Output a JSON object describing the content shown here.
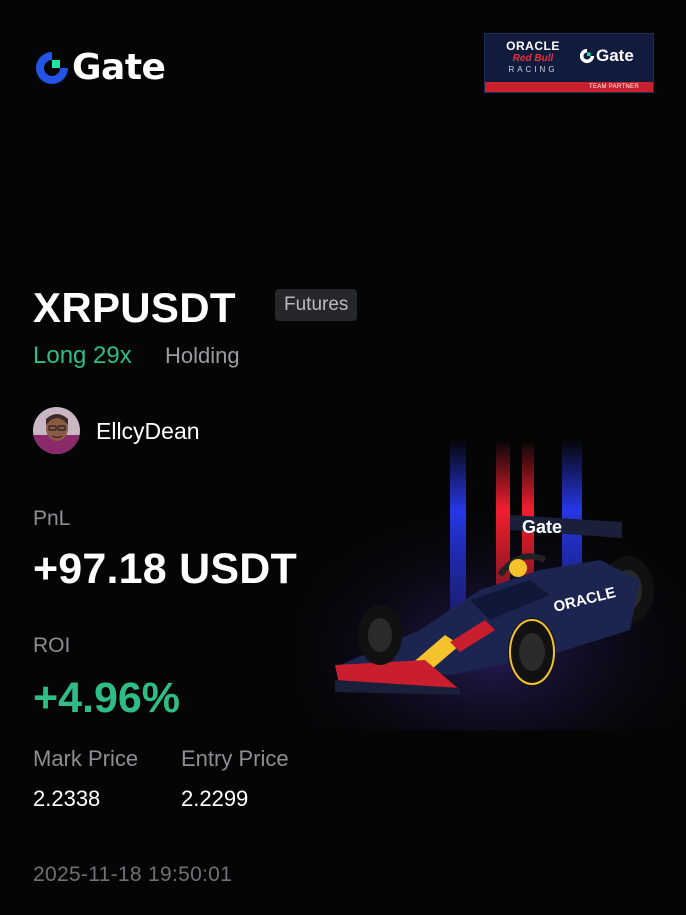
{
  "brand": {
    "name": "Gate",
    "logo_icon": "gate-logo-icon"
  },
  "partner": {
    "oracle": "ORACLE",
    "redbull": "Red Bull",
    "racing": "RACING",
    "gate": "Gate",
    "team_partner": "TEAM PARTNER"
  },
  "position": {
    "pair": "XRPUSDT",
    "type_tag": "Futures",
    "side": "Long 29x",
    "status": "Holding"
  },
  "user": {
    "name": "EllcyDean",
    "avatar_icon": "user-avatar"
  },
  "pnl": {
    "label": "PnL",
    "value": "+97.18 USDT"
  },
  "roi": {
    "label": "ROI",
    "value": "+4.96%"
  },
  "prices": {
    "mark_label": "Mark Price",
    "mark_value": "2.2338",
    "entry_label": "Entry Price",
    "entry_value": "2.2299"
  },
  "timestamp": "2025-11-18 19:50:01",
  "car_wing_text": "Gate",
  "car_side_text": "ORACLE",
  "colors": {
    "background": "#050506",
    "positive": "#2fbd85",
    "muted": "#8d8e94",
    "brand_blue": "#2354e6",
    "brand_green": "#17e6a1"
  }
}
